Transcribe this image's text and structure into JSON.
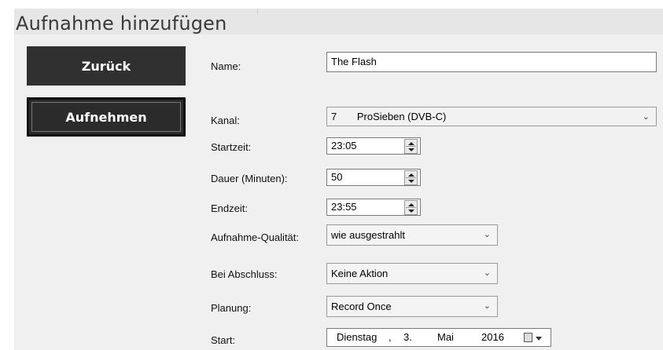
{
  "header": {
    "title": "Aufnahme hinzufügen"
  },
  "buttons": {
    "back": "Zurück",
    "record": "Aufnehmen"
  },
  "form": {
    "name": {
      "label": "Name:",
      "value": "The Flash"
    },
    "channel": {
      "label": "Kanal:",
      "number": "7",
      "name": "ProSieben (DVB-C)"
    },
    "start_time": {
      "label": "Startzeit:",
      "value": "23:05"
    },
    "duration": {
      "label": "Dauer (Minuten):",
      "value": "50"
    },
    "end_time": {
      "label": "Endzeit:",
      "value": "23:55"
    },
    "quality": {
      "label": "Aufnahme-Qualität:",
      "value": "wie ausgestrahlt"
    },
    "on_complete": {
      "label": "Bei Abschluss:",
      "value": "Keine Aktion"
    },
    "schedule": {
      "label": "Planung:",
      "value": "Record Once"
    },
    "start_date": {
      "label": "Start:",
      "weekday": "Dienstag",
      "sep": ",",
      "day": "3.",
      "month": "Mai",
      "year": "2016"
    }
  },
  "icons": {
    "dropdown": "chevron-down-icon",
    "spinner": "spin-arrows-icon",
    "calendar": "calendar-icon"
  }
}
